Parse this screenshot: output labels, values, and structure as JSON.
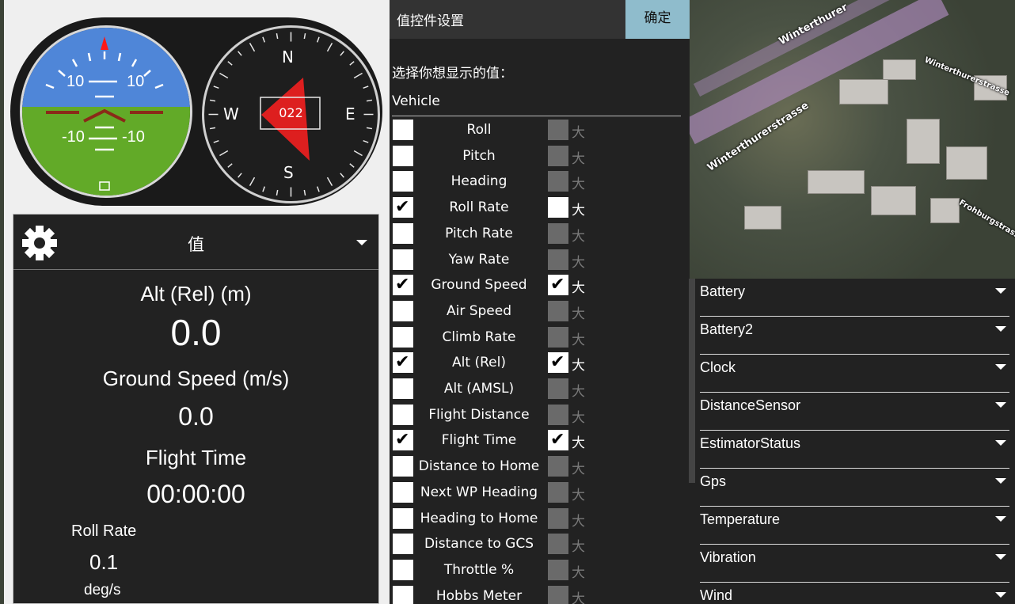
{
  "map": {
    "street_names": [
      "Winterthurerstrasse",
      "Winterthurerstrasse",
      "Winterthurerstrasse",
      "Frohburgstrasse"
    ],
    "street_partial": "Winterthurer"
  },
  "attitude": {
    "pitch_labels": [
      "10",
      "10",
      "-10",
      "-10"
    ]
  },
  "compass": {
    "heading_readout": "022",
    "cardinals": {
      "n": "N",
      "e": "E",
      "s": "S",
      "w": "W"
    }
  },
  "value_widget": {
    "header_title": "值",
    "values": [
      {
        "label": "Alt (Rel) (m)",
        "value": "0.0"
      },
      {
        "label": "Ground Speed (m/s)",
        "value": "0.0"
      },
      {
        "label": "Flight Time",
        "value": "00:00:00"
      }
    ],
    "small_value": {
      "label": "Roll Rate",
      "value": "0.1",
      "unit": "deg/s"
    }
  },
  "dialog": {
    "title": "值控件设置",
    "ok_label": "确定",
    "prompt": "选择你想显示的值：",
    "section": "Vehicle",
    "large_label": "大",
    "rows": [
      {
        "label": "Roll",
        "show": false,
        "large": false
      },
      {
        "label": "Pitch",
        "show": false,
        "large": false
      },
      {
        "label": "Heading",
        "show": false,
        "large": false
      },
      {
        "label": "Roll Rate",
        "show": true,
        "large": false,
        "large_enabled": true
      },
      {
        "label": "Pitch Rate",
        "show": false,
        "large": false
      },
      {
        "label": "Yaw Rate",
        "show": false,
        "large": false
      },
      {
        "label": "Ground Speed",
        "show": true,
        "large": true
      },
      {
        "label": "Air Speed",
        "show": false,
        "large": false
      },
      {
        "label": "Climb Rate",
        "show": false,
        "large": false
      },
      {
        "label": "Alt (Rel)",
        "show": true,
        "large": true
      },
      {
        "label": "Alt (AMSL)",
        "show": false,
        "large": false
      },
      {
        "label": "Flight Distance",
        "show": false,
        "large": false
      },
      {
        "label": "Flight Time",
        "show": true,
        "large": true
      },
      {
        "label": "Distance to Home",
        "show": false,
        "large": false
      },
      {
        "label": "Next WP Heading",
        "show": false,
        "large": false
      },
      {
        "label": "Heading to Home",
        "show": false,
        "large": false
      },
      {
        "label": "Distance to GCS",
        "show": false,
        "large": false
      },
      {
        "label": "Throttle %",
        "show": false,
        "large": false
      },
      {
        "label": "Hobbs Meter",
        "show": false,
        "large": false
      }
    ]
  },
  "instrument_list": {
    "items": [
      "Battery",
      "Battery2",
      "Clock",
      "DistanceSensor",
      "EstimatorStatus",
      "Gps",
      "Temperature",
      "Vibration",
      "Wind"
    ]
  },
  "colors": {
    "sky": "#4f86d8",
    "ground": "#62aa28",
    "ok_button": "#8fbccc",
    "compass_needle": "#ff2020"
  }
}
